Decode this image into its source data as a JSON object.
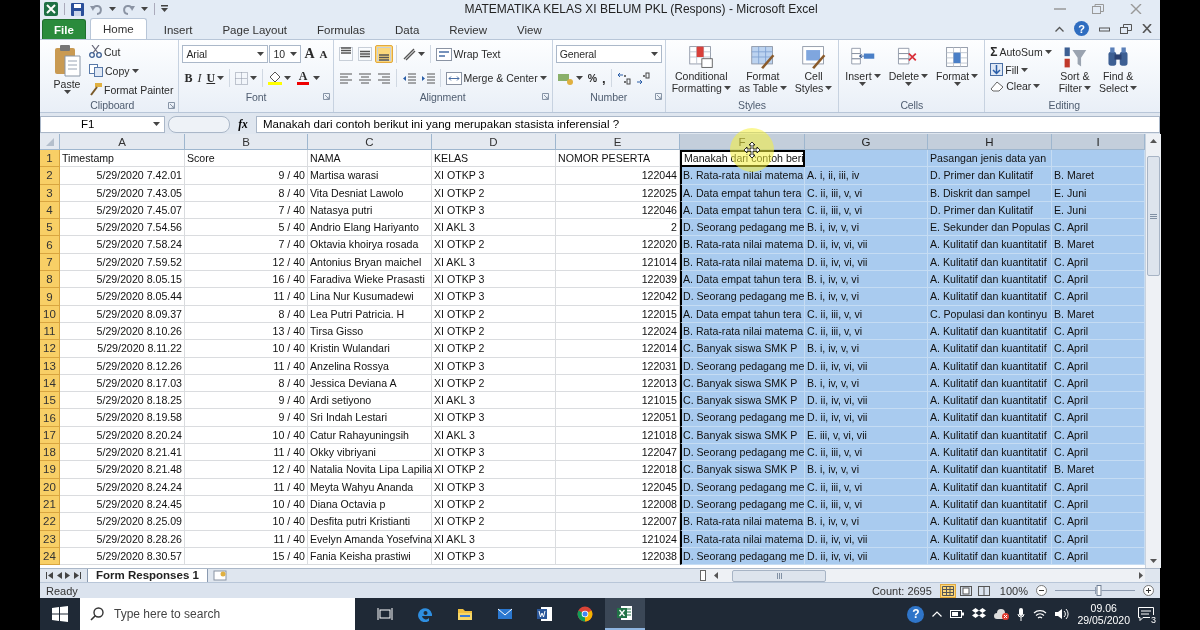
{
  "window": {
    "title": "MATEMATIKA KELAS XI BELUM PKL (Respons)  -  Microsoft Excel",
    "help_glyph": "?"
  },
  "ribbon_tabs": [
    {
      "label": "File",
      "kind": "file",
      "selected": false
    },
    {
      "label": "Home",
      "kind": "tab",
      "selected": true
    },
    {
      "label": "Insert",
      "kind": "tab",
      "selected": false
    },
    {
      "label": "Page Layout",
      "kind": "tab",
      "selected": false
    },
    {
      "label": "Formulas",
      "kind": "tab",
      "selected": false
    },
    {
      "label": "Data",
      "kind": "tab",
      "selected": false
    },
    {
      "label": "Review",
      "kind": "tab",
      "selected": false
    },
    {
      "label": "View",
      "kind": "tab",
      "selected": false
    }
  ],
  "ribbon": {
    "clipboard": {
      "label": "Clipboard",
      "paste": "Paste",
      "cut": "Cut",
      "copy": "Copy",
      "format_painter": "Format Painter"
    },
    "font": {
      "label": "Font",
      "font_name": "Arial",
      "font_size": "10",
      "grow": "A",
      "shrink": "A",
      "bold": "B",
      "italic": "I",
      "underline": "U",
      "font_color": "A"
    },
    "alignment": {
      "label": "Alignment",
      "vertical": [
        {
          "selected": false
        },
        {
          "selected": false
        },
        {
          "selected": true
        }
      ],
      "wrap_text": "Wrap Text",
      "merge_center": "Merge & Center"
    },
    "number": {
      "label": "Number",
      "format": "General",
      "percent": "%",
      "comma": ","
    },
    "styles": {
      "label": "Styles",
      "buttons": [
        {
          "lines": [
            "Conditional",
            "Formatting"
          ]
        },
        {
          "lines": [
            "Format",
            "as Table"
          ]
        },
        {
          "lines": [
            "Cell",
            "Styles"
          ]
        }
      ]
    },
    "cells": {
      "label": "Cells",
      "buttons": [
        {
          "lines": [
            "Insert"
          ]
        },
        {
          "lines": [
            "Delete"
          ]
        },
        {
          "lines": [
            "Format"
          ]
        }
      ]
    },
    "editing": {
      "label": "Editing",
      "autosum_glyph": "Σ",
      "autosum": "AutoSum",
      "fill": "Fill",
      "clear": "Clear",
      "buttons": [
        {
          "lines": [
            "Sort &",
            "Filter"
          ]
        },
        {
          "lines": [
            "Find &",
            "Select"
          ]
        }
      ]
    }
  },
  "formula_bar": {
    "name_box": "F1",
    "fx": "fx",
    "formula": "Manakah dari contoh berikut ini yang merupakan stasista inferensial ?"
  },
  "grid": {
    "columns": [
      {
        "letter": "A",
        "selected": false
      },
      {
        "letter": "B",
        "selected": false
      },
      {
        "letter": "C",
        "selected": false
      },
      {
        "letter": "D",
        "selected": false
      },
      {
        "letter": "E",
        "selected": false
      },
      {
        "letter": "F",
        "selected": true
      },
      {
        "letter": "G",
        "selected": true
      },
      {
        "letter": "H",
        "selected": true
      },
      {
        "letter": "I",
        "selected": true
      }
    ],
    "rows": [
      {
        "number": "1",
        "selected": true,
        "active": true,
        "cells": [
          "Timestamp",
          "Score",
          "NAMA",
          "KELAS",
          "NOMOR PESERTA",
          "Manakah dari contoh beri",
          null,
          "Pasangan jenis data yan",
          null
        ]
      },
      {
        "number": "2",
        "selected": true,
        "active": false,
        "cells": [
          "5/29/2020 7.42.01",
          "9 / 40",
          "Martisa warasi",
          "XI OTKP 3",
          "122044",
          "B. Rata-rata nilai matema",
          "A. i, ii, iii, iv",
          "D. Primer dan Kulitatif",
          "B. Maret"
        ]
      },
      {
        "number": "3",
        "selected": true,
        "active": false,
        "cells": [
          "5/29/2020 7.43.05",
          "8 / 40",
          "Vita Desniat Lawolo",
          "XI OTKP 2",
          "122025",
          "A. Data empat tahun tera",
          "C. ii, iii, v, vi",
          "B. Diskrit dan sampel",
          "E. Juni"
        ]
      },
      {
        "number": "4",
        "selected": true,
        "active": false,
        "cells": [
          "5/29/2020 7.45.07",
          "7 / 40",
          "Natasya putri",
          "XI OTKP 3",
          "122046",
          "A. Data empat tahun tera",
          "C. ii, iii, v, vi",
          "D. Primer dan Kulitatif",
          "E. Juni"
        ]
      },
      {
        "number": "5",
        "selected": true,
        "active": false,
        "cells": [
          "5/29/2020 7.54.56",
          "5 / 40",
          "Andrio Elang Hariyanto",
          "XI AKL 3",
          "2",
          "D. Seorang pedagang me",
          "B. i, iv, v, vi",
          "E. Sekunder dan Populas",
          "C. April"
        ]
      },
      {
        "number": "6",
        "selected": true,
        "active": false,
        "cells": [
          "5/29/2020 7.58.24",
          "7 / 40",
          "Oktavia khoirya rosada",
          "XI OTKP 2",
          "122020",
          "B. Rata-rata nilai matema",
          "D. ii, iv, vi, vii",
          "A. Kulitatif dan kuantitatif",
          "B. Maret"
        ]
      },
      {
        "number": "7",
        "selected": true,
        "active": false,
        "cells": [
          "5/29/2020 7.59.52",
          "12 / 40",
          "Antonius Bryan maichel",
          "XI AKL 3",
          "121014",
          "B. Rata-rata nilai matema",
          "D. ii, iv, vi, vii",
          "A. Kulitatif dan kuantitatif",
          "C. April"
        ]
      },
      {
        "number": "8",
        "selected": true,
        "active": false,
        "cells": [
          "5/29/2020 8.05.15",
          "16 / 40",
          "Faradiva Wieke Prasasti",
          "XI OTKP 3",
          "122039",
          "A. Data empat tahun tera",
          "B. i, iv, v, vi",
          "A. Kulitatif dan kuantitatif",
          "C. April"
        ]
      },
      {
        "number": "9",
        "selected": true,
        "active": false,
        "cells": [
          "5/29/2020 8.05.44",
          "11 / 40",
          "Lina Nur Kusumadewi",
          "XI OTKP 3",
          "122042",
          "D. Seorang pedagang me",
          "B. i, iv, v, vi",
          "A. Kulitatif dan kuantitatif",
          "C. April"
        ]
      },
      {
        "number": "10",
        "selected": true,
        "active": false,
        "cells": [
          "5/29/2020 8.09.37",
          "8 / 40",
          "Lea Putri Patricia. H",
          "XI OTKP 2",
          "122015",
          "A. Data empat tahun tera",
          "C. ii, iii, v, vi",
          "C. Populasi dan kontinyu",
          "B. Maret"
        ]
      },
      {
        "number": "11",
        "selected": true,
        "active": false,
        "cells": [
          "5/29/2020 8.10.26",
          "13 / 40",
          "Tirsa Gisso",
          "XI OTKP 2",
          "122024",
          "B. Rata-rata nilai matema",
          "C. ii, iii, v, vi",
          "A. Kulitatif dan kuantitatif",
          "C. April"
        ]
      },
      {
        "number": "12",
        "selected": true,
        "active": false,
        "cells": [
          "5/29/2020 8.11.22",
          "10 / 40",
          "Kristin Wulandari",
          "XI OTKP 2",
          "122014",
          "C. Banyak siswa SMK P",
          "B. i, iv, v, vi",
          "A. Kulitatif dan kuantitatif",
          "C. April"
        ]
      },
      {
        "number": "13",
        "selected": true,
        "active": false,
        "cells": [
          "5/29/2020 8.12.26",
          "11 / 40",
          "Anzelina Rossya",
          "XI OTKP 3",
          "122031",
          "D. Seorang pedagang me",
          "D. ii, iv, vi, vii",
          "A. Kulitatif dan kuantitatif",
          "C. April"
        ]
      },
      {
        "number": "14",
        "selected": true,
        "active": false,
        "cells": [
          "5/29/2020 8.17.03",
          "8 / 40",
          "Jessica Deviana A",
          "XI OTKP 2",
          "122013",
          "C. Banyak siswa SMK P",
          "B. i, iv, v, vi",
          "A. Kulitatif dan kuantitatif",
          "C. April"
        ]
      },
      {
        "number": "15",
        "selected": true,
        "active": false,
        "cells": [
          "5/29/2020 8.18.25",
          "9 / 40",
          "Ardi setiyono",
          "XI AKL 3",
          "121015",
          "C. Banyak siswa SMK P",
          "D. ii, iv, vi, vii",
          "A. Kulitatif dan kuantitatif",
          "C. April"
        ]
      },
      {
        "number": "16",
        "selected": true,
        "active": false,
        "cells": [
          "5/29/2020 8.19.58",
          "9 / 40",
          "Sri Indah Lestari",
          "XI OTKP 3",
          "122051",
          "D. Seorang pedagang me",
          "D. ii, iv, vi, vii",
          "A. Kulitatif dan kuantitatif",
          "C. April"
        ]
      },
      {
        "number": "17",
        "selected": true,
        "active": false,
        "cells": [
          "5/29/2020 8.20.24",
          "10 / 40",
          "Catur Rahayuningsih",
          "XI AKL 3",
          "121018",
          "C. Banyak siswa SMK P",
          "E. iii, v, vi, vii",
          "A. Kulitatif dan kuantitatif",
          "C. April"
        ]
      },
      {
        "number": "18",
        "selected": true,
        "active": false,
        "cells": [
          "5/29/2020 8.21.41",
          "11 / 40",
          "Okky vibriyani",
          "XI OTKP 3",
          "122047",
          "D. Seorang pedagang me",
          "C. ii, iii, v, vi",
          "A. Kulitatif dan kuantitatif",
          "C. April"
        ]
      },
      {
        "number": "19",
        "selected": true,
        "active": false,
        "cells": [
          "5/29/2020 8.21.48",
          "12 / 40",
          "Natalia Novita Lipa Lapilia",
          "XI OTKP 2",
          "122018",
          "C. Banyak siswa SMK P",
          "B. i, iv, v, vi",
          "A. Kulitatif dan kuantitatif",
          "B. Maret"
        ]
      },
      {
        "number": "20",
        "selected": true,
        "active": false,
        "cells": [
          "5/29/2020 8.24.24",
          "11 / 40",
          "Meyta Wahyu Ananda",
          "XI OTKP 3",
          "122045",
          "D. Seorang pedagang me",
          "C. ii, iii, v, vi",
          "A. Kulitatif dan kuantitatif",
          "C. April"
        ]
      },
      {
        "number": "21",
        "selected": true,
        "active": false,
        "cells": [
          "5/29/2020 8.24.45",
          "10 / 40",
          "Diana Octavia p",
          "XI OTKP 2",
          "122008",
          "D. Seorang pedagang me",
          "C. ii, iii, v, vi",
          "A. Kulitatif dan kuantitatif",
          "C. April"
        ]
      },
      {
        "number": "22",
        "selected": true,
        "active": false,
        "cells": [
          "5/29/2020 8.25.09",
          "10 / 40",
          "Desfita putri Kristianti",
          "XI OTKP 2",
          "122007",
          "B. Rata-rata nilai matema",
          "B. i, iv, v, vi",
          "A. Kulitatif dan kuantitatif",
          "C. April"
        ]
      },
      {
        "number": "23",
        "selected": true,
        "active": false,
        "cells": [
          "5/29/2020 8.28.26",
          "11 / 40",
          "Evelyn Amanda Yosefvina",
          "XI AKL 3",
          "121024",
          "B. Rata-rata nilai matema",
          "D. ii, iv, vi, vii",
          "A. Kulitatif dan kuantitatif",
          "C. April"
        ]
      },
      {
        "number": "24",
        "selected": true,
        "active": false,
        "cells": [
          "5/29/2020 8.30.57",
          "15 / 40",
          "Fania Keisha prastiwi",
          "XI OTKP 3",
          "122038",
          "D. Seorang pedagang me",
          "D. ii, iv, vi, vii",
          "A. Kulitatif dan kuantitatif",
          "C. April"
        ]
      }
    ]
  },
  "sheet_tabs": [
    {
      "label": "Form Responses 1",
      "selected": true
    }
  ],
  "status_bar": {
    "mode": "Ready",
    "count": "Count: 2695",
    "views": [
      {
        "selected": true
      },
      {
        "selected": false
      },
      {
        "selected": false
      }
    ],
    "zoom": "100%",
    "zoom_slider": {
      "level": 0.55
    }
  },
  "taskbar": {
    "search_placeholder": "Type here to search",
    "apps": [
      {
        "selected": false
      },
      {
        "selected": false
      },
      {
        "selected": false
      },
      {
        "selected": false
      },
      {
        "selected": false
      },
      {
        "selected": false
      },
      {
        "selected": true
      }
    ],
    "help_glyph": "?",
    "time": "09.06",
    "date": "29/05/2020",
    "notifications": "3"
  }
}
